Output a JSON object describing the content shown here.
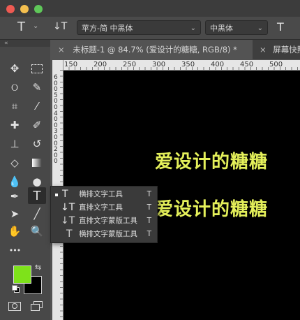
{
  "window": {
    "traffic_lights": {
      "close": "#ee5a52",
      "minimize": "#f4bf4f",
      "maximize": "#5fc759"
    }
  },
  "options_bar": {
    "tool_glyph": "T",
    "orientation_glyph": "↓T",
    "font_family": "苹方-简 中黑体",
    "font_style": "中黑体",
    "size_glyph": "T"
  },
  "tabs": [
    {
      "close": "×",
      "label": "未标题-1 @ 84.7% (爱设计的糖糖, RGB/8) *",
      "active": true
    },
    {
      "close": "×",
      "label": "屏幕快照",
      "active": false
    }
  ],
  "ruler": {
    "h_labels": [
      "150",
      "200",
      "250",
      "300",
      "350",
      "400",
      "450",
      "500"
    ],
    "v_labels": [
      "6",
      "0",
      "0",
      "5",
      "0",
      "0",
      "4",
      "0",
      "0",
      "3",
      "0",
      "0",
      "2",
      "0",
      "0"
    ]
  },
  "canvas": {
    "text_color": "#e4f05a",
    "line1": "爱设计的糖糖",
    "line2": "爱设计的糖糖"
  },
  "flyout": {
    "items": [
      {
        "icon": "T",
        "label": "横排文字工具",
        "key": "T",
        "selected": true
      },
      {
        "icon": "↓T",
        "label": "直排文字工具",
        "key": "T",
        "selected": false
      },
      {
        "icon": "↓T",
        "label": "直排文字蒙版工具",
        "key": "T",
        "selected": false
      },
      {
        "icon": "T",
        "label": "横排文字蒙版工具",
        "key": "T",
        "selected": false
      }
    ]
  },
  "toolbar": {
    "collapse": "«",
    "more": "•••",
    "foreground_color": "#7ee21a",
    "background_color": "#000000"
  }
}
